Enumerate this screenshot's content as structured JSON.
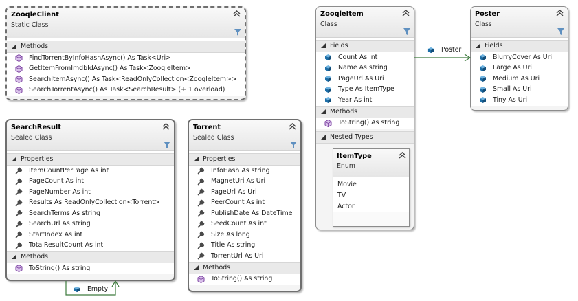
{
  "classes": {
    "zooqle_client": {
      "name": "ZooqleClient",
      "stereotype": "Static Class",
      "sections": [
        {
          "label": "Methods",
          "items": [
            "FindTorrentByInfoHashAsync() As Task<Uri>",
            "GetItemFromImdbIdAsync() As Task<ZooqleItem>",
            "SearchItemAsync()  As  Task<ReadOnlyCollection<ZooqleItem>>",
            "SearchTorrentAsync() As Task<SearchResult> (+ 1 overload)"
          ]
        }
      ]
    },
    "search_result": {
      "name": "SearchResult",
      "stereotype": "Sealed Class",
      "sections": [
        {
          "label": "Properties",
          "items": [
            "ItemCountPerPage As int",
            "PageCount As int",
            "PageNumber As int",
            "Results As ReadOnlyCollection<Torrent>",
            "SearchTerms As string",
            "SearchUrl As string",
            "StartIndex As int",
            "TotalResultCount As int"
          ]
        },
        {
          "label": "Methods",
          "items": [
            "ToString() As string"
          ]
        }
      ]
    },
    "torrent": {
      "name": "Torrent",
      "stereotype": "Sealed Class",
      "sections": [
        {
          "label": "Properties",
          "items": [
            "InfoHash As string",
            "MagnetUri As Uri",
            "PageUrl As Uri",
            "PeerCount As int",
            "PublishDate As DateTime",
            "SeedCount As int",
            "Size As long",
            "Title As string",
            "TorrentUrl As Uri"
          ]
        },
        {
          "label": "Methods",
          "items": [
            "ToString() As string"
          ]
        }
      ]
    },
    "zooqle_item": {
      "name": "ZooqleItem",
      "stereotype": "Class",
      "sections": [
        {
          "label": "Fields",
          "items": [
            "Count As int",
            "Name As string",
            "PageUrl As Uri",
            "Type As ItemType",
            "Year As int"
          ]
        },
        {
          "label": "Methods",
          "items": [
            "ToString() As string"
          ]
        },
        {
          "label": "Nested Types",
          "items": []
        }
      ],
      "nested": {
        "name": "ItemType",
        "stereotype": "Enum",
        "values": [
          "Movie",
          "TV",
          "Actor"
        ]
      }
    },
    "poster": {
      "name": "Poster",
      "stereotype": "Class",
      "sections": [
        {
          "label": "Fields",
          "items": [
            "BlurryCover As Uri",
            "Large As Uri",
            "Medium As Uri",
            "Small As Uri",
            "Tiny As Uri"
          ]
        }
      ]
    }
  },
  "associations": {
    "poster": {
      "label": "Poster",
      "icon": "field-icon"
    },
    "empty": {
      "label": "Empty",
      "icon": "field-icon"
    }
  },
  "colors": {
    "connector": "#3e7b3e",
    "field_icon": "#1d6fa8",
    "method_icon": "#7a3fa0",
    "property_icon": "#4a4a4a"
  }
}
